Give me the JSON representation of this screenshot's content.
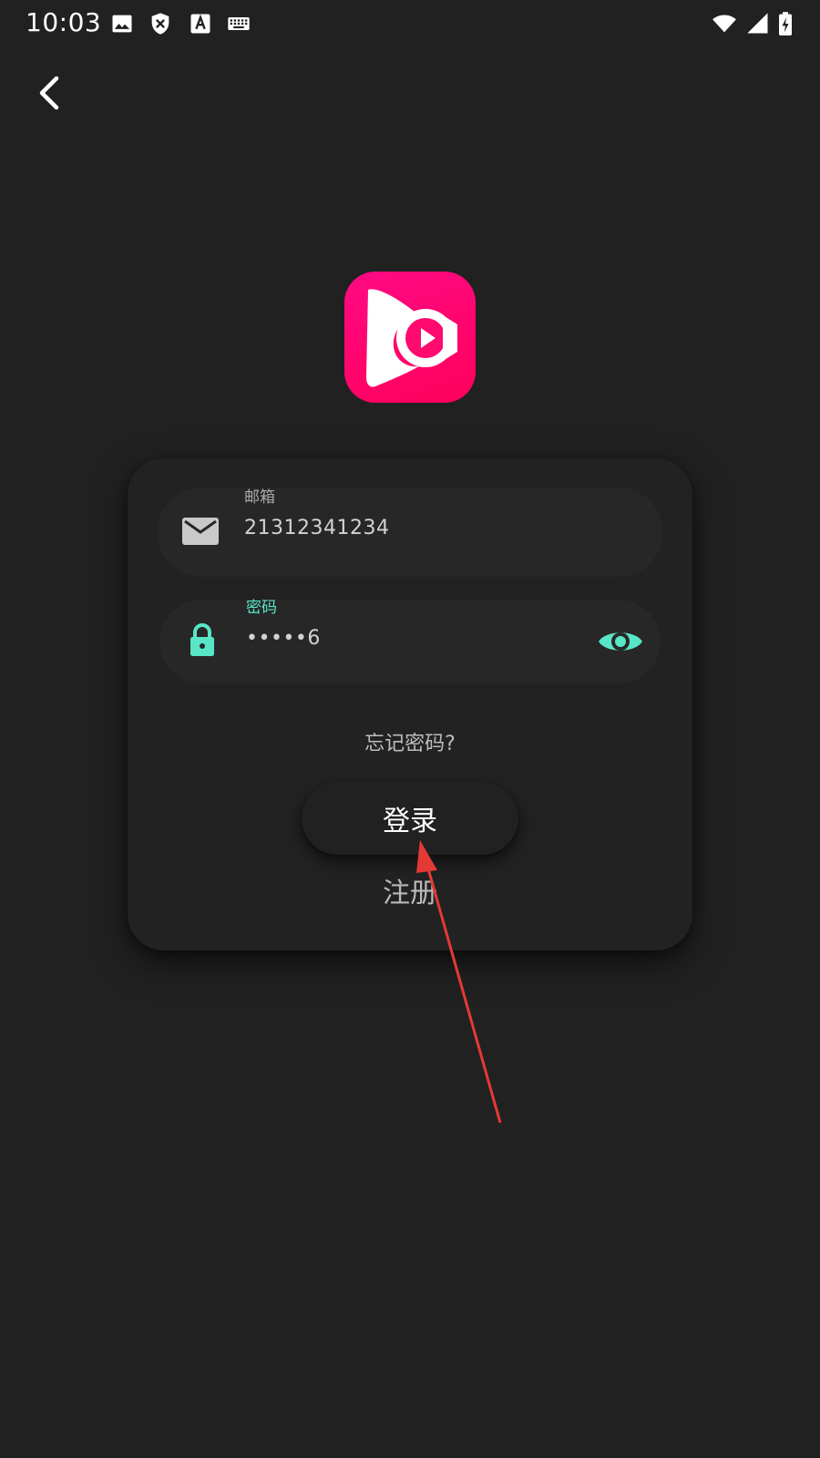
{
  "status_bar": {
    "time": "10:03",
    "left_icons": [
      "image-icon",
      "shield-x-icon",
      "text-a-icon",
      "keyboard-icon"
    ],
    "right_icons": [
      "wifi-icon",
      "cell-signal-icon",
      "battery-charging-icon"
    ]
  },
  "nav": {
    "back_icon": "chevron-left-icon"
  },
  "logo": {
    "icon": "app-logo-play-icon",
    "colors": [
      "#ff0a84",
      "#ff005a"
    ]
  },
  "login_form": {
    "email": {
      "label": "邮箱",
      "value": "21312341234",
      "icon": "mail-icon"
    },
    "password": {
      "label": "密码",
      "value": "•••••6",
      "icon": "lock-icon",
      "toggle_icon": "eye-icon"
    },
    "forgot_password": "忘记密码?",
    "login_button": "登录",
    "register_link": "注册"
  },
  "colors": {
    "background": "#212121",
    "accent": "#58e6c6",
    "annotation_arrow": "#e53935"
  }
}
